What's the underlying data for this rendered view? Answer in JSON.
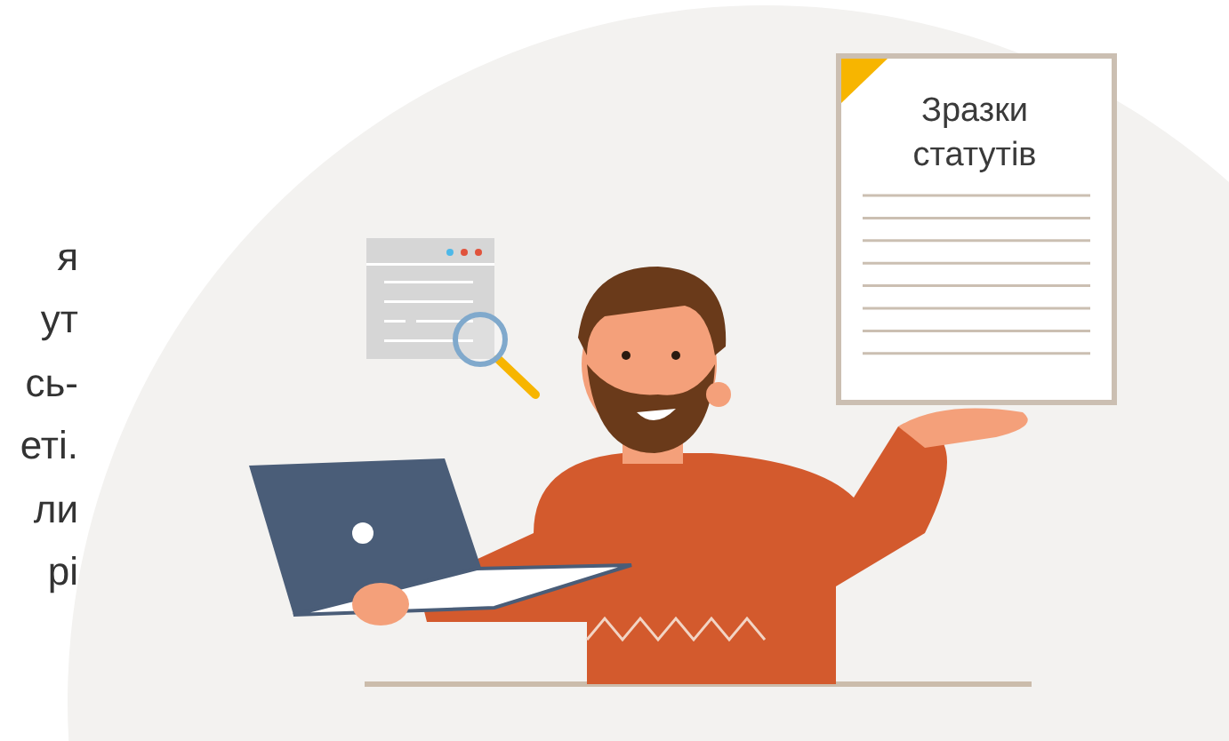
{
  "intro_text": {
    "lines": [
      "я",
      "ут",
      "сь-",
      "еті.",
      "ли",
      "рі"
    ]
  },
  "document": {
    "title_lines": [
      "Зразки",
      "статутів"
    ]
  }
}
